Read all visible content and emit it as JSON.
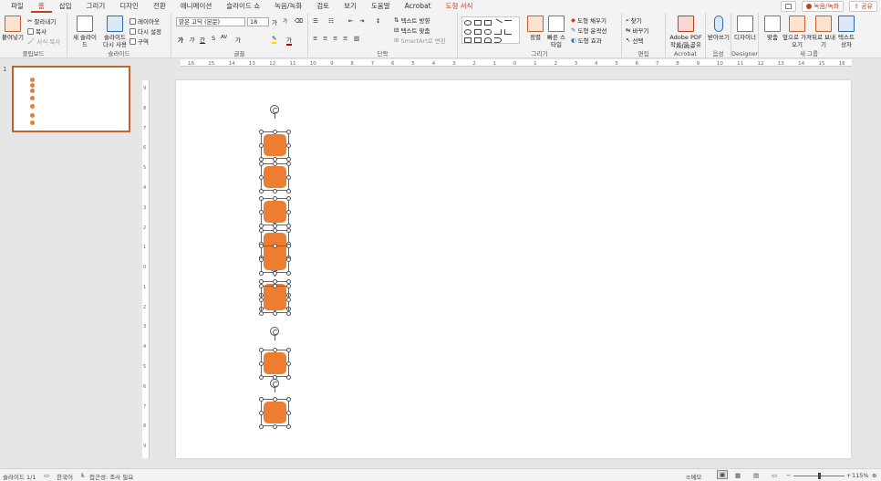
{
  "menubar": {
    "tabs": [
      "파일",
      "홈",
      "삽입",
      "그리기",
      "디자인",
      "전환",
      "애니메이션",
      "슬라이드 쇼",
      "녹음/녹화",
      "검토",
      "보기",
      "도움말",
      "Acrobat",
      "도형 서식"
    ],
    "active_tab": "홈",
    "context_tab": "도형 서식",
    "record_label": "녹음/녹화",
    "share_label": "공유"
  },
  "ribbon": {
    "clipboard": {
      "paste": "붙여넣기",
      "cut": "잘라내기",
      "copy": "복사",
      "format_painter": "서식 복사",
      "label": "클립보드"
    },
    "slides": {
      "new_slide": "새 슬라이드",
      "reuse_slide": "슬라이드 다시 사용",
      "layout": "레이아웃",
      "reset": "다시 설정",
      "section": "구역",
      "label": "슬라이드"
    },
    "font": {
      "font_name": "맑은 고딕 (본문)",
      "font_size": "18",
      "grow": "가",
      "shrink": "가",
      "bold": "가",
      "italic": "가",
      "underline": "간",
      "strike": "S",
      "spacing": "AV",
      "case": "가",
      "label": "글꼴"
    },
    "paragraph": {
      "text_direction": "텍스트 방향",
      "align_text": "텍스트 맞춤",
      "smartart": "SmartArt로 변환",
      "label": "단락"
    },
    "drawing": {
      "arrange": "정렬",
      "quick_styles": "빠른 스타일",
      "fill": "도형 채우기",
      "outline": "도형 윤곽선",
      "effects": "도형 효과",
      "label": "그리기"
    },
    "editing": {
      "find": "찾기",
      "replace": "바꾸기",
      "select": "선택",
      "label": "편집"
    },
    "acrobat": {
      "create_share": "Adobe PDF 작성 및 공유",
      "label": "Adobe Acrobat"
    },
    "voice": {
      "dictate": "받아쓰기",
      "label": "음성"
    },
    "designer": {
      "designer": "디자이너",
      "label": "Designer"
    },
    "newgroup": {
      "align": "맞춤",
      "bring_forward": "앞으로 가져오기",
      "send_backward": "뒤로 보내기",
      "text_box": "텍스트 상자",
      "label": "새 그룹"
    }
  },
  "hruler": {
    "ticks": [
      "16",
      "15",
      "14",
      "13",
      "12",
      "11",
      "10",
      "9",
      "8",
      "7",
      "6",
      "5",
      "4",
      "3",
      "2",
      "1",
      "0",
      "1",
      "2",
      "3",
      "4",
      "5",
      "6",
      "7",
      "8",
      "9",
      "10",
      "11",
      "12",
      "13",
      "14",
      "15",
      "16"
    ]
  },
  "vruler": {
    "ticks": [
      "9",
      "8",
      "7",
      "6",
      "5",
      "4",
      "3",
      "2",
      "1",
      "0",
      "1",
      "2",
      "3",
      "4",
      "5",
      "6",
      "7",
      "8",
      "9"
    ]
  },
  "thumbnails": {
    "slide_number": "1"
  },
  "statusbar": {
    "slide_info": "슬라이드 1/1",
    "language": "한국어",
    "accessibility": "접근성: 조사 필요",
    "notes": "메모",
    "zoom": "115%",
    "zoom_fraction": 0.5
  },
  "colors": {
    "accent": "#c43e1c",
    "shape_fill": "#ed7d31"
  }
}
